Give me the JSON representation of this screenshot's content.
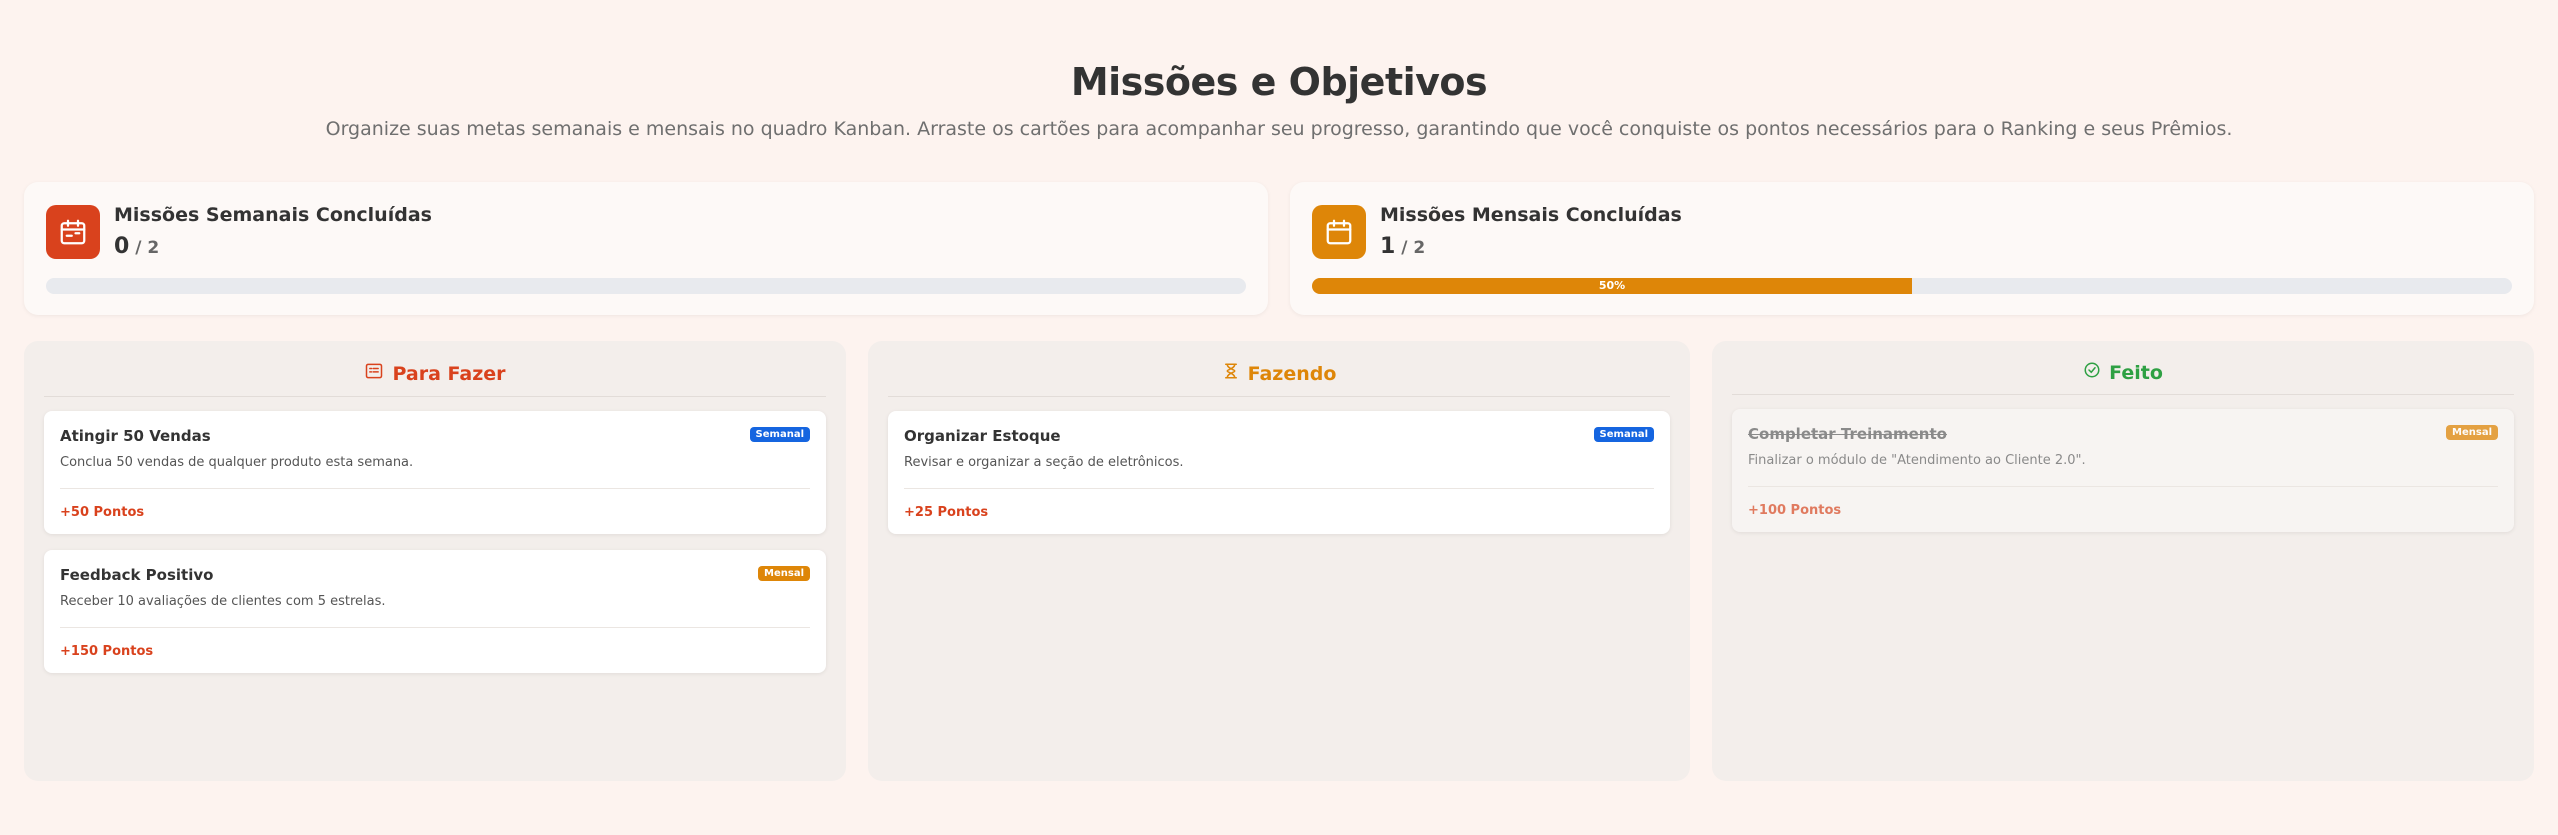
{
  "header": {
    "title": "Missões e Objetivos",
    "subtitle": "Organize suas metas semanais e mensais no quadro Kanban. Arraste os cartões para acompanhar seu progresso, garantindo que você conquiste os pontos necessários para o Ranking e seus Prêmios."
  },
  "stats": {
    "weekly": {
      "icon": "calendar-week-icon",
      "title": "Missões Semanais Concluídas",
      "done": "0",
      "sep": " / ",
      "total": "2",
      "progress": 0,
      "progress_label": ""
    },
    "monthly": {
      "icon": "calendar-icon",
      "title": "Missões Mensais Concluídas",
      "done": "1",
      "sep": " / ",
      "total": "2",
      "progress": 0.5,
      "progress_label": "50%"
    }
  },
  "colors": {
    "accent_red": "#d9421d",
    "accent_orange": "#de8608",
    "done_green": "#2ea043",
    "badge_semanal": "#1565e0",
    "badge_mensal": "#de8608"
  },
  "columns": {
    "todo": {
      "title": "Para Fazer",
      "icon": "list-icon",
      "cards": [
        {
          "title": "Atingir 50 Vendas",
          "badge": "Semanal",
          "desc": "Conclua 50 vendas de qualquer produto esta semana.",
          "points": "+50 Pontos"
        },
        {
          "title": "Feedback Positivo",
          "badge": "Mensal",
          "desc": "Receber 10 avaliações de clientes com 5 estrelas.",
          "points": "+150 Pontos"
        }
      ]
    },
    "doing": {
      "title": "Fazendo",
      "icon": "hourglass-icon",
      "cards": [
        {
          "title": "Organizar Estoque",
          "badge": "Semanal",
          "desc": "Revisar e organizar a seção de eletrônicos.",
          "points": "+25 Pontos"
        }
      ]
    },
    "done": {
      "title": "Feito",
      "icon": "check-circle-icon",
      "cards": [
        {
          "title": "Completar Treinamento",
          "badge": "Mensal",
          "desc": "Finalizar o módulo de \"Atendimento ao Cliente 2.0\".",
          "points": "+100 Pontos"
        }
      ]
    }
  }
}
